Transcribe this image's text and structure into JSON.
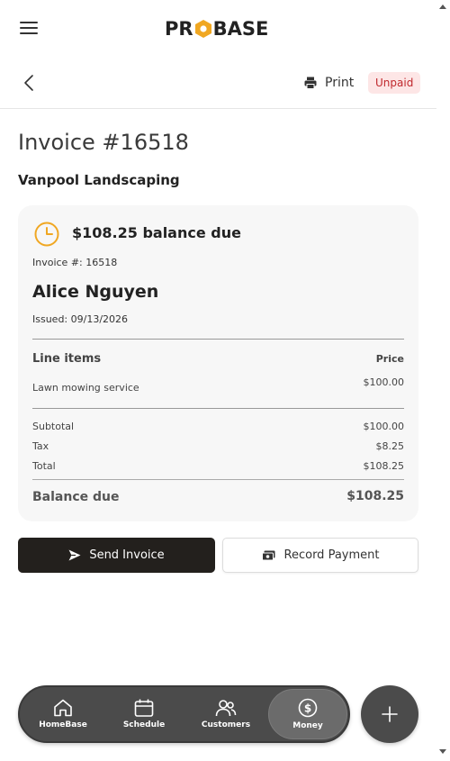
{
  "header": {
    "logo_text_left": "PR",
    "logo_text_right": "BASE",
    "print_label": "Print",
    "status": "Unpaid"
  },
  "invoice": {
    "title": "Invoice #16518",
    "company": "Vanpool Landscaping",
    "balance_headline": "$108.25 balance due",
    "invoice_number": "Invoice #: 16518",
    "customer": "Alice Nguyen",
    "issued": "Issued: 09/13/2026",
    "line_items_header": "Line items",
    "price_header": "Price",
    "line_items": [
      {
        "description": "Lawn mowing service",
        "price": "$100.00"
      }
    ],
    "subtotal_label": "Subtotal",
    "subtotal": "$100.00",
    "tax_label": "Tax",
    "tax": "$8.25",
    "total_label": "Total",
    "total": "$108.25",
    "balance_due_label": "Balance due",
    "balance_due": "$108.25"
  },
  "actions": {
    "send": "Send Invoice",
    "record": "Record Payment"
  },
  "nav": {
    "items": [
      {
        "label": "HomeBase",
        "icon": "home-icon"
      },
      {
        "label": "Schedule",
        "icon": "calendar-icon"
      },
      {
        "label": "Customers",
        "icon": "users-icon"
      },
      {
        "label": "Money",
        "icon": "dollar-icon",
        "active": true
      }
    ]
  },
  "colors": {
    "accent_orange": "#f0a722",
    "dark": "#23201d",
    "badge_bg": "#fde6e6",
    "badge_text": "#c0282d"
  }
}
